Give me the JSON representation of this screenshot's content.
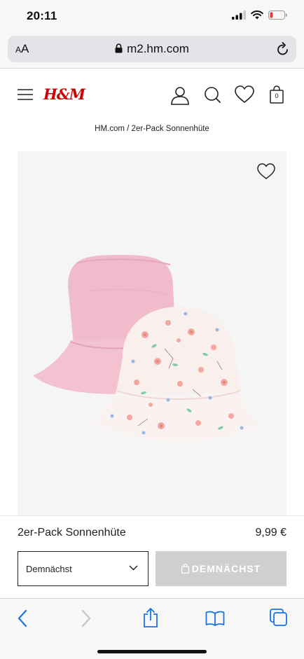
{
  "status_bar": {
    "time": "20:11"
  },
  "browser": {
    "aa_small": "A",
    "aa_large": "A",
    "url": "m2.hm.com"
  },
  "header": {
    "logo": "H&M",
    "bag_count": "0"
  },
  "breadcrumb": "HM.com / 2er-Pack Sonnenhüte",
  "product": {
    "name": "2er-Pack Sonnenhüte",
    "price": "9,99 €",
    "size_select_value": "Demnächst",
    "add_button_label": "DEMNÄCHST"
  },
  "colors": {
    "brand_red": "#cc0000",
    "ios_blue": "#1a73e8",
    "disabled_button": "#cfcfcf"
  }
}
